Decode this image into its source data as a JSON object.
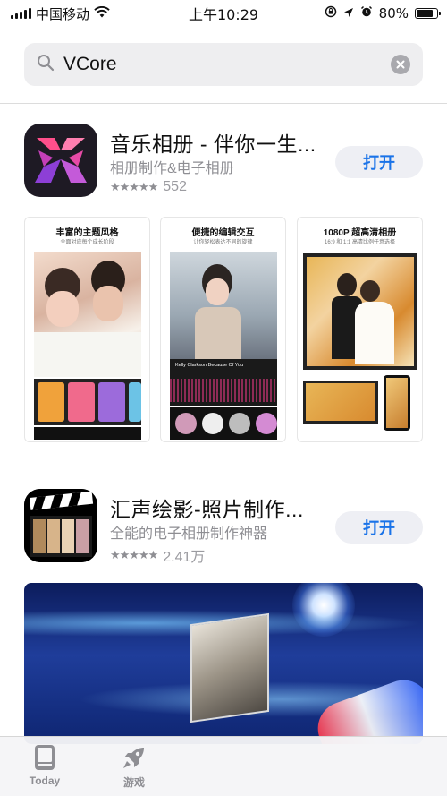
{
  "status_bar": {
    "carrier": "中国移动",
    "time": "上午10:29",
    "battery": "80%",
    "battery_level": 0.8
  },
  "search": {
    "query": "VCore",
    "placeholder": ""
  },
  "apps": [
    {
      "title": "音乐相册 - 伴你一生...",
      "subtitle": "相册制作&电子相册",
      "stars": "★★★★★",
      "rating_count": "552",
      "action": "打开",
      "screenshots": [
        {
          "title": "丰富的主题风格",
          "subtitle": "全面对应每个成长阶段",
          "note": "Kelly Clarkson Because Of You"
        },
        {
          "title": "便捷的编辑交互",
          "subtitle": "让你轻松表达不同的旋律",
          "note": "Kelly Clarkson Because Of You"
        },
        {
          "title": "1080P 超高清相册",
          "subtitle": "16:9 和 1:1 高清比例任意选择",
          "note": ""
        }
      ]
    },
    {
      "title": "汇声绘影-照片制作...",
      "subtitle": "全能的电子相册制作神器",
      "stars": "★★★★★",
      "rating_count": "2.41万",
      "action": "打开"
    }
  ],
  "tabs": [
    {
      "label": "Today",
      "icon": "today-icon"
    },
    {
      "label": "游戏",
      "icon": "rocket-icon"
    }
  ],
  "colors": {
    "accent": "#1a73e8",
    "button_bg": "#eeeff4",
    "secondary_text": "#8e8e93"
  }
}
